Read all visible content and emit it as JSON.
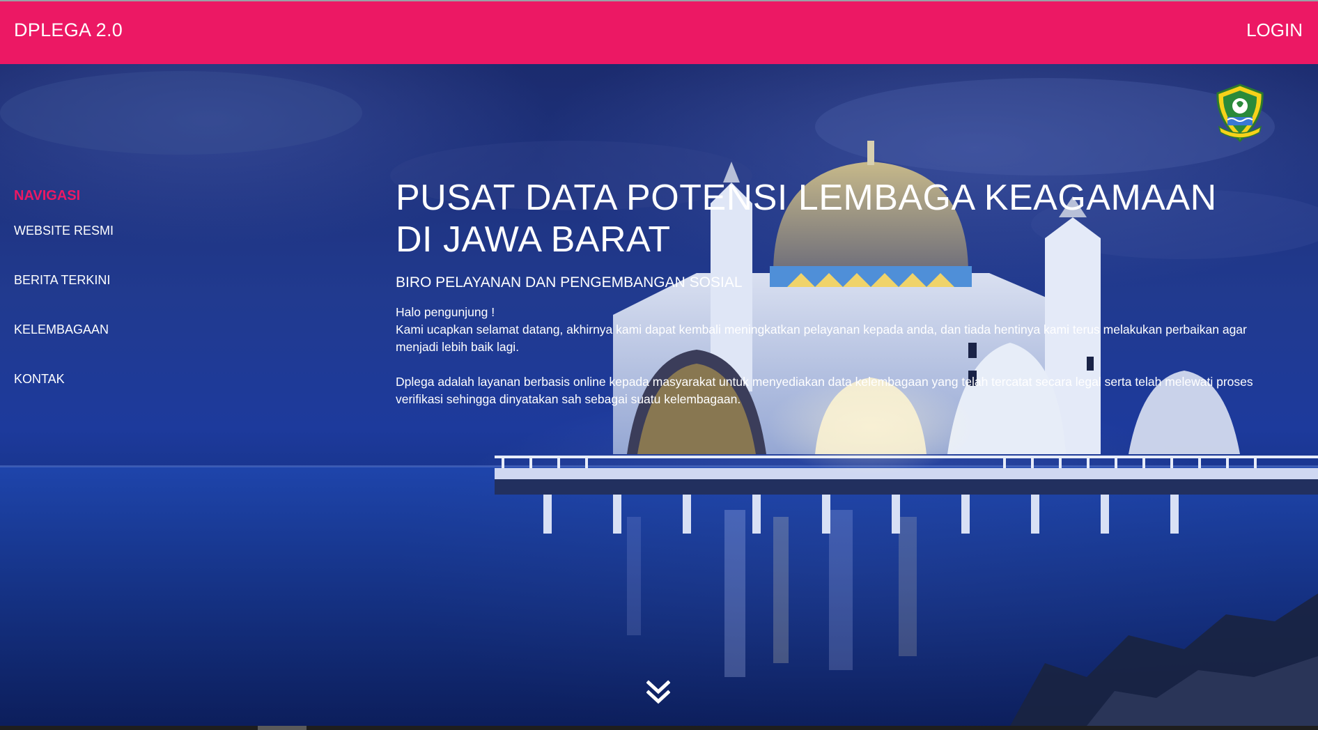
{
  "header": {
    "brand": "DPLEGA 2.0",
    "login_label": "LOGIN",
    "background_color": "#ec1864"
  },
  "sidebar": {
    "title": "NAVIGASI",
    "items": [
      {
        "label": "WEBSITE RESMI"
      },
      {
        "label": "BERITA TERKINI"
      },
      {
        "label": "KELEMBAGAAN"
      },
      {
        "label": "KONTAK"
      }
    ]
  },
  "hero": {
    "title_line1": "PUSAT DATA POTENSI LEMBAGA KEAGAMAAN",
    "title_line2": "DI JAWA BARAT",
    "subtitle": "BIRO PELAYANAN DAN PENGEMBANGAN SOSIAL",
    "greeting": "Halo pengunjung !",
    "paragraph1": "Kami ucapkan selamat datang, akhirnya kami dapat kembali meningkatkan pelayanan kepada anda, dan tiada hentinya kami terus melakukan perbaikan agar menjadi lebih baik lagi.",
    "paragraph2": "Dplega adalah layanan berbasis online kepada masyarakat untuk menyediakan data kelembagaan yang telah tercatat secara legal serta telah melewati proses verifikasi sehingga dinyatakan sah sebagai suatu kelembagaan.",
    "scroll_icon": "double-chevron-down-icon",
    "emblem_icon": "west-java-emblem-icon"
  }
}
